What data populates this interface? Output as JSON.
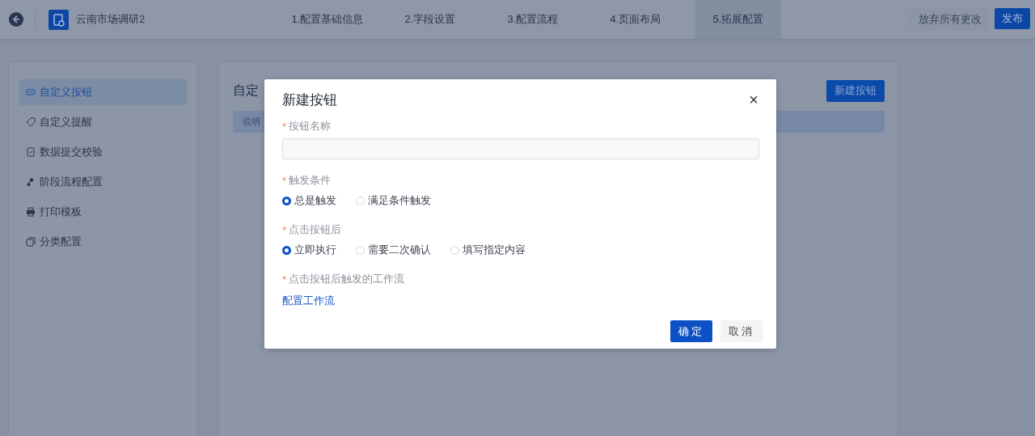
{
  "header": {
    "app_name": "云南市场调研2",
    "steps": [
      {
        "label": "1.配置基础信息",
        "selected": false
      },
      {
        "label": "2.字段设置",
        "selected": false
      },
      {
        "label": "3.配置流程",
        "selected": false
      },
      {
        "label": "4.页面布局",
        "selected": false
      },
      {
        "label": "5.拓展配置",
        "selected": true
      }
    ],
    "discard_button": "放弃所有更改",
    "publish_button": "发布"
  },
  "sidebar": {
    "items": [
      {
        "label": "自定义按钮",
        "selected": true
      },
      {
        "label": "自定义提醒",
        "selected": false
      },
      {
        "label": "数据提交校验",
        "selected": false
      },
      {
        "label": "阶段流程配置",
        "selected": false
      },
      {
        "label": "打印模板",
        "selected": false
      },
      {
        "label": "分类配置",
        "selected": false
      }
    ]
  },
  "content": {
    "title": "自定",
    "new_button": "新建按钮",
    "notice": "说明"
  },
  "dialog": {
    "title": "新建按钮",
    "close": "×",
    "fields": [
      {
        "kind": "text",
        "label": "按钮名称",
        "required_mark": "*"
      },
      {
        "kind": "radio",
        "label": "触发条件",
        "required_mark": "*",
        "options": [
          {
            "label": "总是触发",
            "selected": true
          },
          {
            "label": "满足条件触发",
            "selected": false
          }
        ]
      },
      {
        "kind": "radio",
        "label": "点击按钮后",
        "required_mark": "*",
        "options": [
          {
            "label": "立即执行",
            "selected": true
          },
          {
            "label": "需要二次确认",
            "selected": false
          },
          {
            "label": "填写指定内容",
            "selected": false
          }
        ]
      },
      {
        "kind": "link",
        "label": "点击按钮后触发的工作流",
        "required_mark": "*",
        "link": "配置工作流"
      }
    ],
    "buttons": [
      {
        "label": "确定",
        "kind": "primary"
      },
      {
        "label": "取消",
        "kind": "secondary"
      }
    ]
  }
}
